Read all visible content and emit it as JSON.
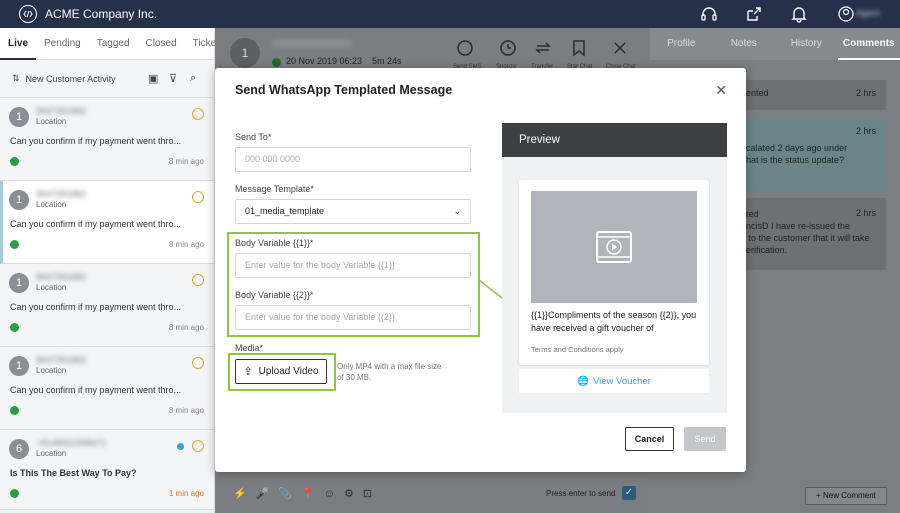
{
  "app": {
    "name": "ACME Company Inc."
  },
  "left": {
    "tabs": [
      "Live",
      "Pending",
      "Tagged",
      "Closed",
      "Tickets"
    ],
    "filter_label": "New Customer Activity",
    "conversations": [
      {
        "avatar": "1",
        "name": "9647391882",
        "location": "Location",
        "message": "Can you confirm if my payment went thro...",
        "time": "8 min ago"
      },
      {
        "avatar": "1",
        "name": "9647391882",
        "location": "Location",
        "message": "Can you confirm if my payment went thro...",
        "time": "8 min ago"
      },
      {
        "avatar": "1",
        "name": "9647391882",
        "location": "Location",
        "message": "Can you confirm if my payment went thro...",
        "time": "8 min ago"
      },
      {
        "avatar": "1",
        "name": "9647391882",
        "location": "Location",
        "message": "Can you confirm if my payment went thro...",
        "time": "8 min ago"
      },
      {
        "avatar": "6",
        "name": "+9148931998471",
        "location": "Location",
        "message": "Is This The Best Way To Pay?",
        "time": "1 min ago"
      }
    ]
  },
  "center": {
    "avatar": "1",
    "date": "20 Nov 2019  06:23",
    "duration": "5m 24s",
    "actions": [
      "Send SMS",
      "Snooze",
      "Transfer",
      "Star Chat",
      "Close Chat"
    ],
    "composer_hint": "Press enter to send"
  },
  "right": {
    "tabs": [
      "Profile",
      "Notes",
      "History",
      "Comments"
    ],
    "comments": [
      {
        "text": "ented",
        "time": "2 hrs"
      },
      {
        "text": "calated 2 days ago under\nhat is the status update?",
        "time": "2 hrs"
      },
      {
        "text": "ted\nncisD I have re-issued the\n to the customer that it will take\nerification.",
        "time": "2 hrs"
      }
    ],
    "new_comment_label": "+ New Comment"
  },
  "modal": {
    "title": "Send WhatsApp Templated Message",
    "send_to_label": "Send To*",
    "send_to_placeholder": "000 000 0000",
    "template_label": "Message Template*",
    "template_value": "01_media_template",
    "var1_label": "Body Variable {{1}}*",
    "var1_placeholder": "Enter value for the body Variable {{1}}",
    "var2_label": "Body Variable {{2}}*",
    "var2_placeholder": "Enter value for the body Variable {{2}}",
    "media_label": "Media*",
    "upload_label": "Upload Video",
    "upload_hint": "Only MP4 with a max file size of 30 MB.",
    "preview_title": "Preview",
    "preview_text": "{{1}}Compliments of the season {{2}}, you have received a gift voucher of",
    "preview_footer": "Terms and Conditions apply",
    "preview_button": "View Voucher",
    "cancel_label": "Cancel",
    "send_label": "Send"
  }
}
